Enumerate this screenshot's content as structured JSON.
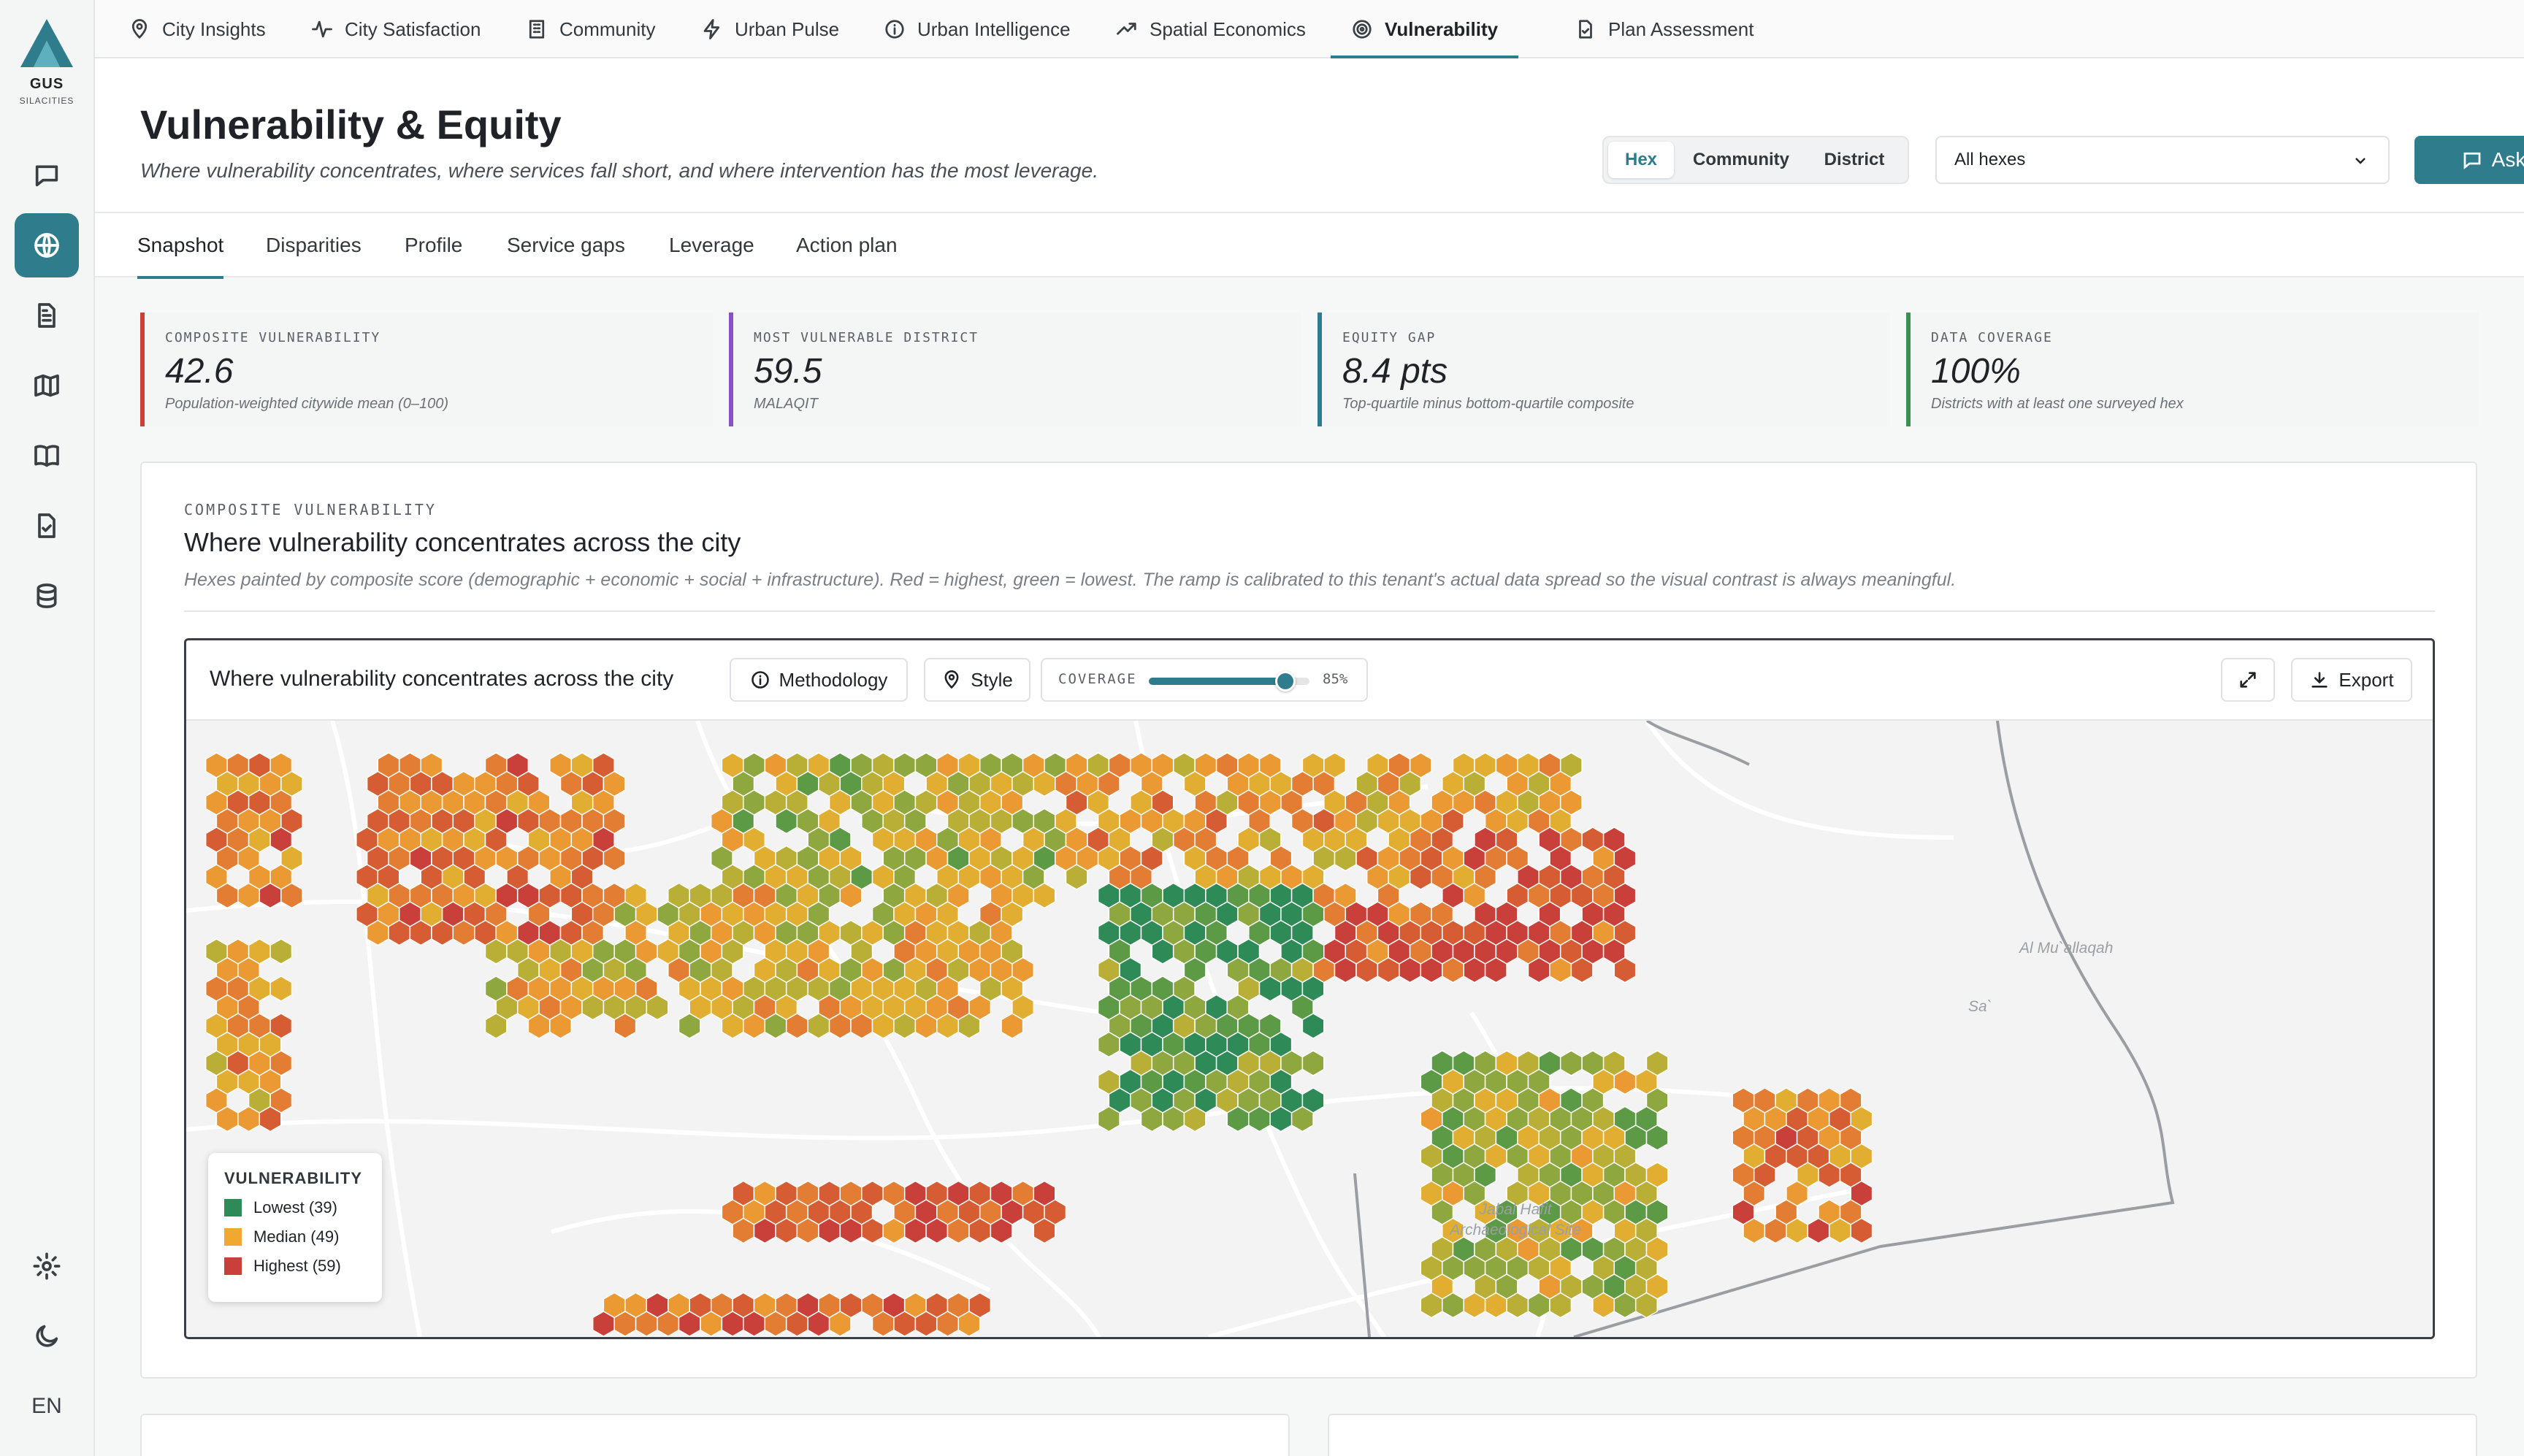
{
  "app": {
    "brand": "GUS",
    "brand_sub": "SILACITIES",
    "language": "EN"
  },
  "topnav": [
    {
      "label": "City Insights",
      "icon": "map-pin-icon"
    },
    {
      "label": "City Satisfaction",
      "icon": "activity-icon"
    },
    {
      "label": "Community",
      "icon": "building-icon"
    },
    {
      "label": "Urban Pulse",
      "icon": "zap-icon"
    },
    {
      "label": "Urban Intelligence",
      "icon": "info-icon"
    },
    {
      "label": "Spatial Economics",
      "icon": "trending-up-icon"
    },
    {
      "label": "Vulnerability",
      "icon": "target-icon"
    },
    {
      "label": "Plan Assessment",
      "icon": "file-check-icon"
    }
  ],
  "active_nav": "Vulnerability",
  "header": {
    "title": "Vulnerability & Equity",
    "subtitle": "Where vulnerability concentrates, where services fall short, and where intervention has the most leverage.",
    "view_options": [
      "Hex",
      "Community",
      "District"
    ],
    "view_selected": "Hex",
    "filter_value": "All hexes",
    "ask_label": "Ask"
  },
  "subtabs": [
    "Snapshot",
    "Disparities",
    "Profile",
    "Service gaps",
    "Leverage",
    "Action plan"
  ],
  "active_subtab": "Snapshot",
  "kpis": [
    {
      "label": "COMPOSITE VULNERABILITY",
      "value": "42.6",
      "sub": "Population-weighted citywide mean (0–100)",
      "color": "#c9403a"
    },
    {
      "label": "MOST VULNERABLE DISTRICT",
      "value": "59.5",
      "sub": "MALAQIT",
      "color": "#8a4fc9"
    },
    {
      "label": "EQUITY GAP",
      "value": "8.4 pts",
      "sub": "Top-quartile minus bottom-quartile composite",
      "color": "#2f7d8c"
    },
    {
      "label": "DATA COVERAGE",
      "value": "100%",
      "sub": "Districts with at least one surveyed hex",
      "color": "#3f8f4f"
    }
  ],
  "panel": {
    "kicker": "COMPOSITE VULNERABILITY",
    "title": "Where vulnerability concentrates across the city",
    "description": "Hexes painted by composite score (demographic + economic + social + infrastructure). Red = highest, green = lowest. The ramp is calibrated to this tenant's actual data spread so the visual contrast is always meaningful."
  },
  "map": {
    "title": "Where vulnerability concentrates across the city",
    "methodology_label": "Methodology",
    "style_label": "Style",
    "coverage_label": "COVERAGE",
    "coverage_value": "85%",
    "coverage_fraction": 0.85,
    "export_label": "Export",
    "place_labels": [
      "Al Mu`allaqah",
      "Sa`",
      "Jabal Hafit Archaeological Site"
    ],
    "legend": {
      "title": "VULNERABILITY",
      "items": [
        {
          "label": "Lowest (39)",
          "color": "#2e8b57"
        },
        {
          "label": "Median (49)",
          "color": "#f0a830"
        },
        {
          "label": "Highest (59)",
          "color": "#c9403a"
        }
      ]
    }
  }
}
